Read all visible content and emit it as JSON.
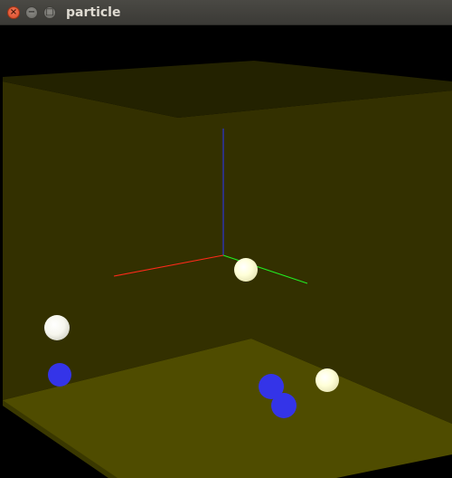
{
  "window": {
    "title": "particle",
    "buttons": {
      "close_glyph": "×",
      "minimize_glyph": "−",
      "maximize_glyph": "□"
    }
  },
  "scene": {
    "colors": {
      "background": "#000000",
      "back_wall": "#333000",
      "side_wall": "#323000",
      "ceiling": "#232200",
      "floor": "#4f4c00",
      "axis_x": "#ff2a1a",
      "axis_y": "#22ee22",
      "axis_z": "#2a33ff",
      "particle_light": "#ffffd0",
      "particle_blue": "#3434e8"
    },
    "particles": [
      {
        "id": "particle-1",
        "color": "light"
      },
      {
        "id": "particle-2",
        "color": "light"
      },
      {
        "id": "particle-3",
        "color": "light"
      },
      {
        "id": "particle-4",
        "color": "blue"
      },
      {
        "id": "particle-5",
        "color": "blue"
      },
      {
        "id": "particle-6",
        "color": "blue"
      }
    ]
  }
}
